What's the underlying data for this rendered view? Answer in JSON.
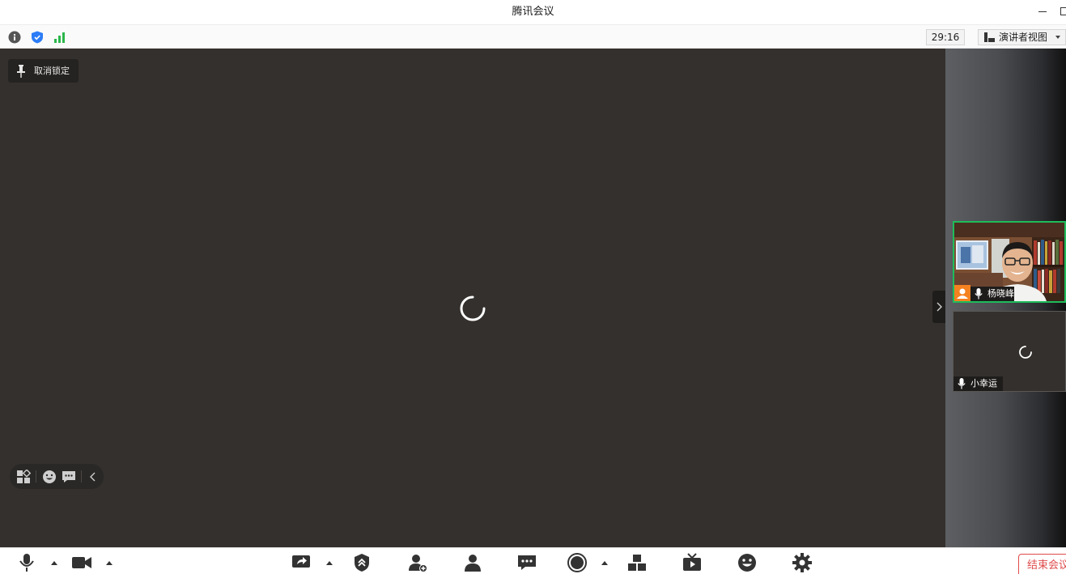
{
  "window": {
    "title": "腾讯会议"
  },
  "infobar": {
    "timer": "29:16",
    "view_label": "演讲者视图"
  },
  "stage": {
    "unpin_label": "取消锁定"
  },
  "participants": [
    {
      "name": "杨晓峰",
      "is_host": true,
      "active_speaker": true
    },
    {
      "name": "小幸运",
      "is_host": false,
      "active_speaker": false
    }
  ],
  "toolbar": {
    "end_meeting_label": "结束会议"
  },
  "colors": {
    "stage_bg": "#33302d",
    "speaker_border": "#1ebc5b",
    "host_badge": "#f58220",
    "end_button": "#e04a4a",
    "security_blue": "#2b7cf6",
    "signal_green": "#2bb64b"
  },
  "icons": [
    "info-icon",
    "shield-icon",
    "signal-icon",
    "speaker-view-icon",
    "pin-icon",
    "loading-spinner-icon",
    "gallery-layout-icon",
    "emoji-icon",
    "chat-bubble-icon",
    "chevron-left-icon",
    "chevron-right-icon",
    "microphone-icon",
    "camera-icon",
    "screen-share-icon",
    "security-icon",
    "invite-icon",
    "participants-icon",
    "chat-icon",
    "record-icon",
    "apps-icon",
    "live-icon",
    "reaction-icon",
    "settings-icon",
    "host-badge-icon"
  ]
}
